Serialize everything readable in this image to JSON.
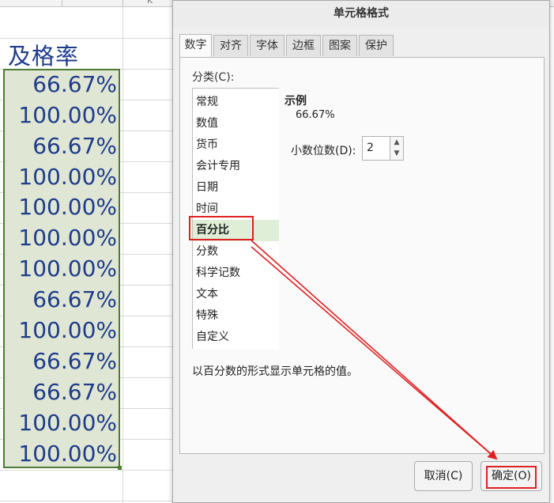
{
  "sheet": {
    "column_title": "及格率",
    "column_letter_hint": "K",
    "values": [
      "66.67%",
      "100.00%",
      "66.67%",
      "100.00%",
      "100.00%",
      "100.00%",
      "100.00%",
      "66.67%",
      "100.00%",
      "66.67%",
      "66.67%",
      "100.00%",
      "100.00%"
    ]
  },
  "dialog": {
    "title": "单元格格式",
    "tabs": [
      "数字",
      "对齐",
      "字体",
      "边框",
      "图案",
      "保护"
    ],
    "active_tab": "数字",
    "category_label": "分类(C):",
    "categories": [
      "常规",
      "数值",
      "货币",
      "会计专用",
      "日期",
      "时间",
      "百分比",
      "分数",
      "科学记数",
      "文本",
      "特殊",
      "自定义"
    ],
    "selected_category": "百分比",
    "sample_title": "示例",
    "sample_value": "66.67%",
    "decimal_label": "小数位数(D):",
    "decimal_value": "2",
    "description": "以百分数的形式显示单元格的值。",
    "cancel_button": "取消(C)",
    "ok_button": "确定(O)"
  },
  "colors": {
    "annotation_red": "#e02020",
    "cell_text_blue": "#1f3c8c",
    "selection_fill": "#dfe6d3",
    "selection_border": "#4d7b34"
  }
}
